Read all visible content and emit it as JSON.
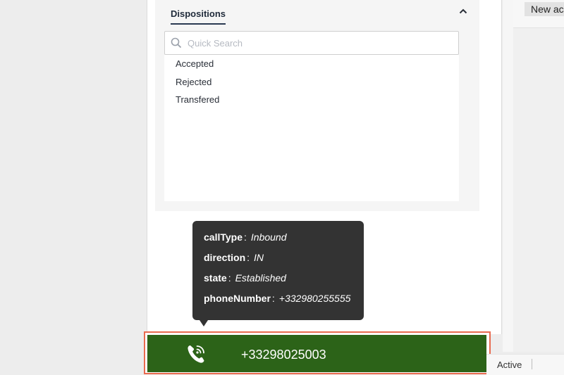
{
  "dispositions": {
    "title": "Dispositions",
    "search_placeholder": "Quick Search",
    "items": [
      "Accepted",
      "Rejected",
      "Transfered"
    ]
  },
  "call_tooltip": {
    "rows": [
      {
        "key": "callType",
        "value": "Inbound"
      },
      {
        "key": "direction",
        "value": "IN"
      },
      {
        "key": "state",
        "value": "Established"
      },
      {
        "key": "phoneNumber",
        "value": "+332980255555"
      }
    ],
    "separator": ":"
  },
  "call_bar": {
    "number": "+33298025003",
    "icon": "phone-call-icon"
  },
  "right_pane": {
    "new_button_label": "New ac"
  },
  "status": {
    "text": "Active"
  },
  "colors": {
    "call_bar_bg": "#2c6318",
    "call_bar_border": "#e86a4f",
    "tooltip_bg": "#333333"
  }
}
